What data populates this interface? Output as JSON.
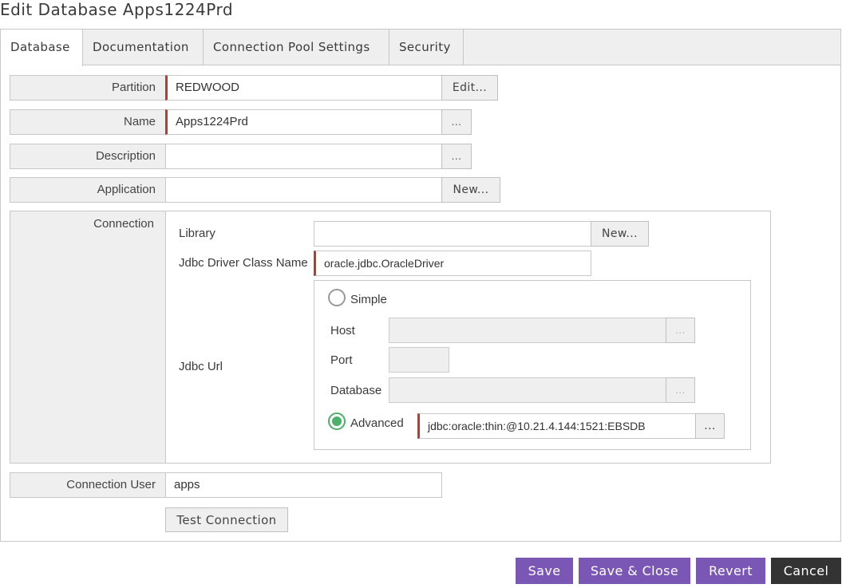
{
  "window": {
    "title": "Edit Database Apps1224Prd"
  },
  "tabs": [
    {
      "label": "Database",
      "active": true
    },
    {
      "label": "Documentation",
      "active": false
    },
    {
      "label": "Connection Pool Settings",
      "active": false
    },
    {
      "label": "Security",
      "active": false
    }
  ],
  "form": {
    "partition": {
      "label": "Partition",
      "value": "REDWOOD",
      "button": "Edit..."
    },
    "name": {
      "label": "Name",
      "value": "Apps1224Prd",
      "button": "..."
    },
    "description": {
      "label": "Description",
      "value": "",
      "button": "..."
    },
    "application": {
      "label": "Application",
      "value": "",
      "button": "New..."
    },
    "connection": {
      "label": "Connection",
      "library": {
        "label": "Library",
        "value": "",
        "button": "New..."
      },
      "driver_class": {
        "label": "Jdbc Driver Class Name",
        "value": "oracle.jdbc.OracleDriver"
      },
      "jdbc_url": {
        "label": "Jdbc Url",
        "simple": {
          "label": "Simple",
          "selected": false,
          "host_label": "Host",
          "host_button": "...",
          "port_label": "Port",
          "database_label": "Database",
          "database_button": "..."
        },
        "advanced": {
          "label": "Advanced",
          "selected": true,
          "value": "jdbc:oracle:thin:@10.21.4.144:1521:EBSDB",
          "button": "..."
        }
      }
    },
    "connection_user": {
      "label": "Connection User",
      "value": "apps"
    },
    "test_connection": "Test Connection"
  },
  "actions": {
    "save": "Save",
    "save_close": "Save & Close",
    "revert": "Revert",
    "cancel": "Cancel"
  },
  "colors": {
    "accent": "#7b57b5",
    "cancel": "#333333",
    "required_marker": "#c0392b",
    "radio_selected": "#4caf6a"
  }
}
